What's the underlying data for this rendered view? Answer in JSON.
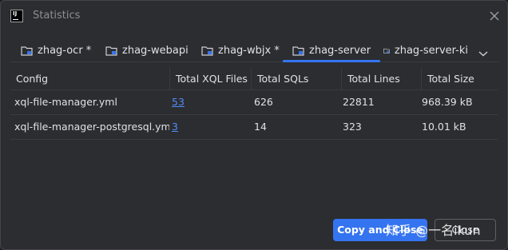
{
  "window": {
    "icon_text": "IJ",
    "title": "Statistics",
    "close_icon": "close-icon"
  },
  "tabs": [
    {
      "label": "zhag-ocr *",
      "icon": "folder-module-icon",
      "active": false
    },
    {
      "label": "zhag-webapi",
      "icon": "folder-module-icon",
      "active": false
    },
    {
      "label": "zhag-wbjx *",
      "icon": "folder-module-icon",
      "active": false
    },
    {
      "label": "zhag-server",
      "icon": "folder-module-icon",
      "active": true
    },
    {
      "label": "zhag-server-ki",
      "icon": "folder-module-icon",
      "active": false
    }
  ],
  "tabs_overflow_icon": "chevron-down-icon",
  "table": {
    "columns": [
      "Config",
      "Total XQL Files",
      "Total SQLs",
      "Total Lines",
      "Total Size"
    ],
    "rows": [
      {
        "config": "xql-file-manager.yml",
        "files": "53",
        "sqls": "626",
        "lines": "22811",
        "size": "968.39 kB"
      },
      {
        "config": "xql-file-manager-postgresql.yml",
        "files": "3",
        "sqls": "14",
        "lines": "323",
        "size": "10.01 kB"
      }
    ]
  },
  "buttons": {
    "copy_label": "Copy and Close",
    "close_label": "Close"
  },
  "watermark": "知乎 @一名ikun",
  "colors": {
    "accent": "#3574f0",
    "link": "#548af7",
    "background": "#2b2d30"
  }
}
